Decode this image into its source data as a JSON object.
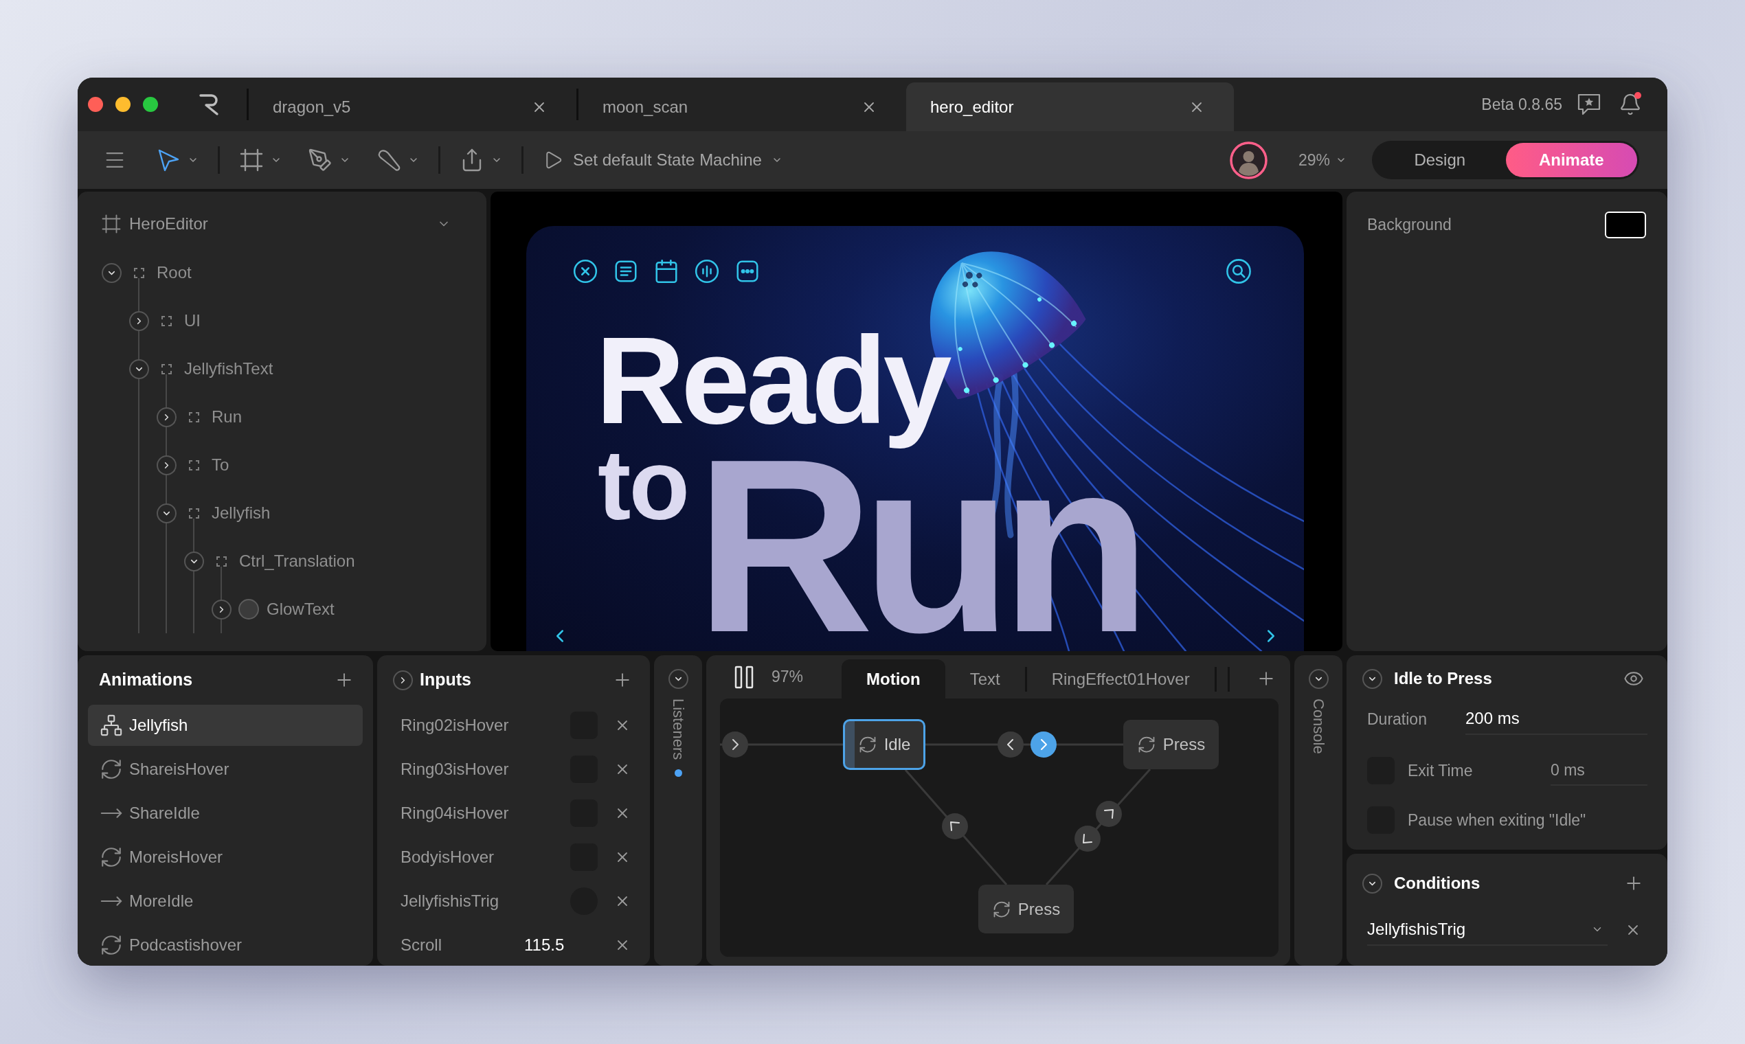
{
  "tabs": [
    {
      "label": "dragon_v5",
      "selected": false
    },
    {
      "label": "moon_scan",
      "selected": false
    },
    {
      "label": "hero_editor",
      "selected": true
    }
  ],
  "version": "Beta 0.8.65",
  "notifications": {
    "unread": true
  },
  "toolbar": {
    "tool_groups": [
      [
        {
          "kind": "pointer",
          "selected": true
        }
      ],
      [
        {
          "kind": "frame",
          "selected": false
        },
        {
          "kind": "pen",
          "selected": false
        },
        {
          "kind": "brush",
          "selected": false
        }
      ],
      [
        {
          "kind": "export",
          "selected": false
        }
      ]
    ],
    "state_machine": "Set default State Machine",
    "zoom": "29%",
    "modes": [
      {
        "label": "Design",
        "selected": false
      },
      {
        "label": "Animate",
        "selected": true
      }
    ]
  },
  "hierarchy": {
    "artboard": "HeroEditor",
    "tree": [
      {
        "label": "Root",
        "kind": "group",
        "expanded": true,
        "children": [
          {
            "label": "UI",
            "kind": "group",
            "expanded": false
          },
          {
            "label": "JellyfishText",
            "kind": "group",
            "expanded": true,
            "children": [
              {
                "label": "Run",
                "kind": "group",
                "expanded": false
              },
              {
                "label": "To",
                "kind": "group",
                "expanded": false
              },
              {
                "label": "Jellyfish",
                "kind": "group",
                "expanded": true,
                "children": [
                  {
                    "label": "Ctrl_Translation",
                    "kind": "group",
                    "expanded": true,
                    "children": [
                      {
                        "label": "GlowText",
                        "kind": "shape",
                        "expanded": false
                      }
                    ]
                  }
                ]
              }
            ]
          }
        ]
      }
    ]
  },
  "artboard": {
    "headline": [
      "Ready",
      "to",
      "Run"
    ]
  },
  "inspector": {
    "background_label": "Background"
  },
  "animations": {
    "title": "Animations",
    "items": [
      {
        "label": "Jellyfish",
        "kind": "state_machine",
        "selected": true
      },
      {
        "label": "ShareisHover",
        "kind": "loop",
        "selected": false
      },
      {
        "label": "ShareIdle",
        "kind": "one_shot",
        "selected": false
      },
      {
        "label": "MoreisHover",
        "kind": "loop",
        "selected": false
      },
      {
        "label": "MoreIdle",
        "kind": "one_shot",
        "selected": false
      },
      {
        "label": "Podcastishover",
        "kind": "loop",
        "selected": false
      }
    ]
  },
  "inputs": {
    "title": "Inputs",
    "expanded": false,
    "items": [
      {
        "label": "Ring02isHover",
        "kind": "boolean",
        "checked": false
      },
      {
        "label": "Ring03isHover",
        "kind": "boolean",
        "checked": false
      },
      {
        "label": "Ring04isHover",
        "kind": "boolean",
        "checked": false
      },
      {
        "label": "BodyisHover",
        "kind": "boolean",
        "checked": false
      },
      {
        "label": "JellyfishisTrig",
        "kind": "trigger"
      },
      {
        "label": "Scroll",
        "kind": "number",
        "value": "115.5"
      }
    ]
  },
  "listeners": {
    "title": "Listeners",
    "indicator": true
  },
  "state_machine": {
    "playing": true,
    "speed": "97%",
    "tabs": [
      {
        "label": "Motion",
        "selected": true
      },
      {
        "label": "Text",
        "selected": false
      },
      {
        "label": "RingEffect01Hover",
        "selected": false
      }
    ],
    "nodes": [
      {
        "label": "Idle",
        "selected": true
      },
      {
        "label": "Press",
        "selected": false
      },
      {
        "label": "Press",
        "selected": false
      }
    ],
    "transitions": [
      {
        "kind": "left",
        "selected": false
      },
      {
        "kind": "right",
        "selected": true
      },
      {
        "kind": "up_left",
        "selected": false
      },
      {
        "kind": "up_right",
        "selected": false
      },
      {
        "kind": "down_left",
        "selected": false
      }
    ]
  },
  "console": {
    "title": "Console"
  },
  "transition": {
    "title": "Idle to Press",
    "expanded": true,
    "duration_label": "Duration",
    "duration": "200 ms",
    "exit_time": {
      "label": "Exit Time",
      "checked": false,
      "value": "0 ms"
    },
    "pause_on_exit": {
      "label": "Pause when exiting \"Idle\"",
      "checked": false
    }
  },
  "conditions": {
    "title": "Conditions",
    "expanded": true,
    "items": [
      {
        "input": "JellyfishisTrig"
      }
    ]
  }
}
